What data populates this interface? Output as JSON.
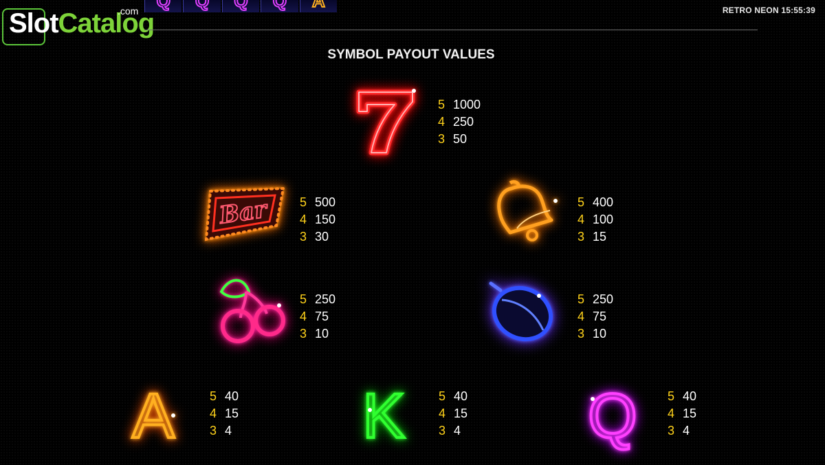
{
  "logo": {
    "slot": "Slot",
    "catalog": "Catalog",
    "com": ".com"
  },
  "reel_strip": [
    "Q",
    "Q",
    "Q",
    "Q",
    "A"
  ],
  "header": {
    "game_title": "RETRO NEON 15:55:39"
  },
  "title": "SYMBOL PAYOUT VALUES",
  "colors": {
    "count": "#ffd21a",
    "value": "#ffffff",
    "logo_green": "#7dd339"
  },
  "symbols": {
    "seven": {
      "icon": "neon-seven",
      "payouts": [
        {
          "count": "5",
          "value": "1000"
        },
        {
          "count": "4",
          "value": "250"
        },
        {
          "count": "3",
          "value": "50"
        }
      ]
    },
    "bar": {
      "icon": "neon-bar",
      "label": "Bar",
      "payouts": [
        {
          "count": "5",
          "value": "500"
        },
        {
          "count": "4",
          "value": "150"
        },
        {
          "count": "3",
          "value": "30"
        }
      ]
    },
    "bell": {
      "icon": "neon-bell",
      "payouts": [
        {
          "count": "5",
          "value": "400"
        },
        {
          "count": "4",
          "value": "100"
        },
        {
          "count": "3",
          "value": "15"
        }
      ]
    },
    "cherry": {
      "icon": "neon-cherry",
      "payouts": [
        {
          "count": "5",
          "value": "250"
        },
        {
          "count": "4",
          "value": "75"
        },
        {
          "count": "3",
          "value": "10"
        }
      ]
    },
    "plum": {
      "icon": "neon-plum",
      "payouts": [
        {
          "count": "5",
          "value": "250"
        },
        {
          "count": "4",
          "value": "75"
        },
        {
          "count": "3",
          "value": "10"
        }
      ]
    },
    "ace": {
      "icon": "neon-letter-a",
      "letter": "A",
      "payouts": [
        {
          "count": "5",
          "value": "40"
        },
        {
          "count": "4",
          "value": "15"
        },
        {
          "count": "3",
          "value": "4"
        }
      ]
    },
    "king": {
      "icon": "neon-letter-k",
      "letter": "K",
      "payouts": [
        {
          "count": "5",
          "value": "40"
        },
        {
          "count": "4",
          "value": "15"
        },
        {
          "count": "3",
          "value": "4"
        }
      ]
    },
    "queen": {
      "icon": "neon-letter-q",
      "letter": "Q",
      "payouts": [
        {
          "count": "5",
          "value": "40"
        },
        {
          "count": "4",
          "value": "15"
        },
        {
          "count": "3",
          "value": "4"
        }
      ]
    }
  }
}
